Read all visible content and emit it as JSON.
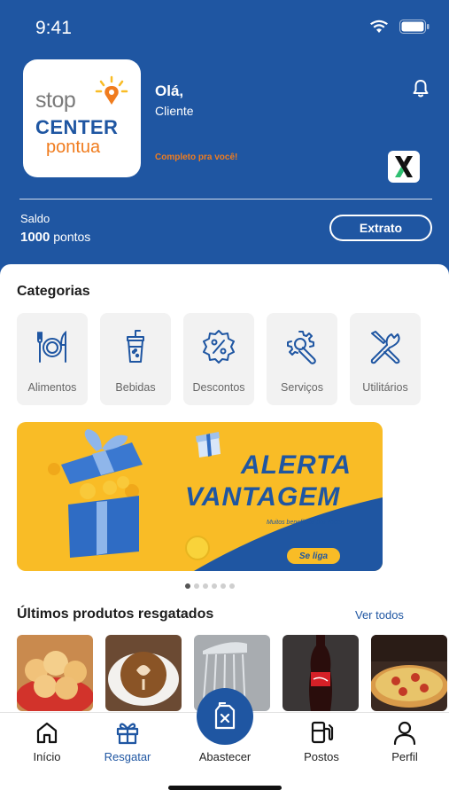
{
  "status": {
    "time": "9:41"
  },
  "logo": {
    "line1": "stop",
    "line2": "CENTER",
    "line3": "pontua"
  },
  "greeting": {
    "hello": "Olá,",
    "name": "Cliente",
    "tagline": "Completo pra você!"
  },
  "balance": {
    "label": "Saldo",
    "amount": "1000",
    "unit": "pontos",
    "statement_button": "Extrato"
  },
  "categories": {
    "title": "Categorias",
    "items": [
      {
        "label": "Alimentos",
        "icon": "cutlery-plate-icon"
      },
      {
        "label": "Bebidas",
        "icon": "drink-cup-icon"
      },
      {
        "label": "Descontos",
        "icon": "discount-badge-icon"
      },
      {
        "label": "Serviços",
        "icon": "gear-wrench-icon"
      },
      {
        "label": "Utilitários",
        "icon": "tools-icon"
      }
    ]
  },
  "banner": {
    "title_line1": "ALERTA",
    "title_line2": "VANTAGEM",
    "subtitle": "Muitos benefícios pra você!",
    "cta": "Se liga",
    "carousel_total": 6,
    "carousel_active": 1
  },
  "recent": {
    "title": "Últimos produtos resgatados",
    "see_all": "Ver todos",
    "products": [
      "cheese-bread",
      "latte-coffee",
      "shower",
      "coca-cola-bottle",
      "pizza"
    ]
  },
  "tabbar": {
    "home": "Início",
    "redeem": "Resgatar",
    "fuel": "Abastecer",
    "stations": "Postos",
    "profile": "Perfil"
  },
  "colors": {
    "primary": "#1f56a2",
    "accent": "#f07c1e",
    "banner_yellow": "#f9bc26"
  }
}
